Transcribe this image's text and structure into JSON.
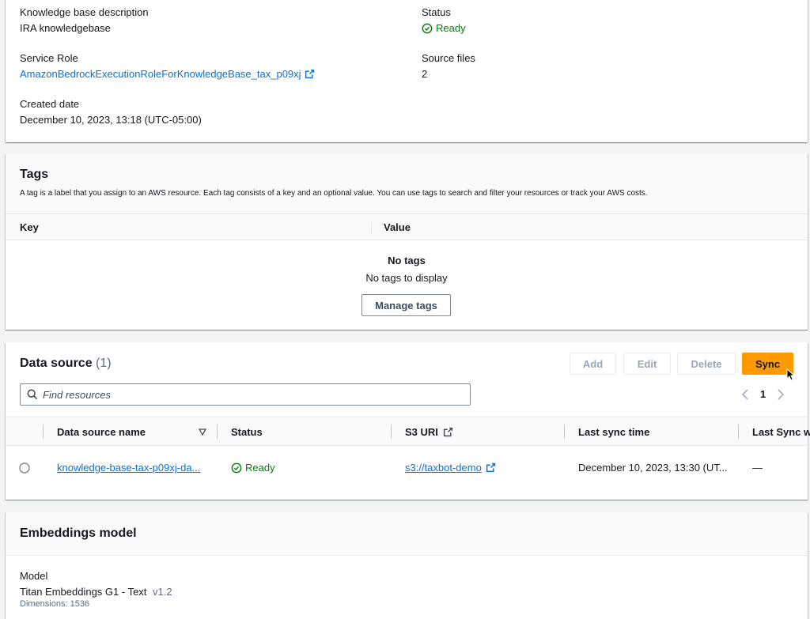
{
  "overview": {
    "kb_desc_label": "Knowledge base description",
    "kb_desc_value": "IRA knowledgebase",
    "status_label": "Status",
    "status_value": "Ready",
    "service_role_label": "Service Role",
    "service_role_value": "AmazonBedrockExecutionRoleForKnowledgeBase_tax_p09xj",
    "source_files_label": "Source files",
    "source_files_value": "2",
    "created_label": "Created date",
    "created_value": "December 10, 2023, 13:18 (UTC-05:00)"
  },
  "tags": {
    "title": "Tags",
    "description": "A tag is a label that you assign to an AWS resource. Each tag consists of a key and an optional value. You can use tags to search and filter your resources or track your AWS costs.",
    "col_key": "Key",
    "col_value": "Value",
    "empty_title": "No tags",
    "empty_sub": "No tags to display",
    "manage_label": "Manage tags"
  },
  "data_source": {
    "title": "Data source",
    "count": "(1)",
    "add_label": "Add",
    "edit_label": "Edit",
    "delete_label": "Delete",
    "sync_label": "Sync",
    "search_placeholder": "Find resources",
    "page": "1",
    "columns": {
      "name": "Data source name",
      "status": "Status",
      "s3uri": "S3 URI",
      "last_sync": "Last sync time",
      "last_sync_warn": "Last Sync wa"
    },
    "rows": [
      {
        "name": "knowledge-base-tax-p09xj-da...",
        "status": "Ready",
        "s3uri": "s3://taxbot-demo",
        "last_sync": "December 10, 2023, 13:30 (UT...",
        "last_sync_warn": "—"
      }
    ]
  },
  "embeddings": {
    "title": "Embeddings model",
    "model_label": "Model",
    "model_name": "Titan Embeddings G1 - Text",
    "model_version": "v1.2",
    "dimensions": "Dimensions: 1536"
  },
  "colors": {
    "link": "#0972d3",
    "success": "#037f0c",
    "primary_button": "#ff9900"
  }
}
